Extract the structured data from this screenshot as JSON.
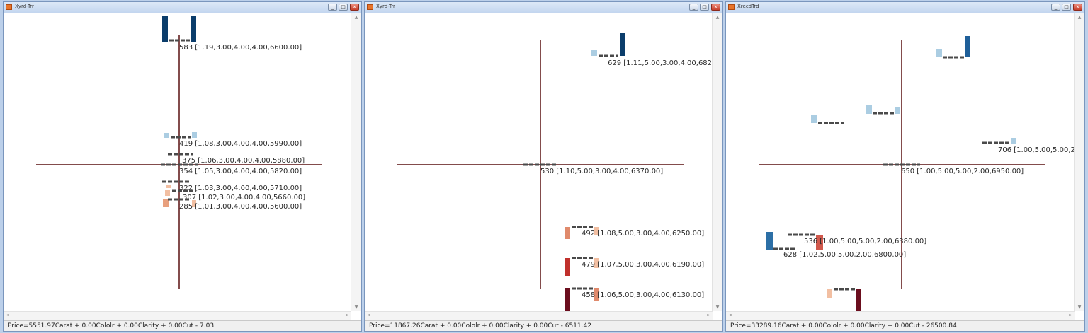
{
  "windows": [
    {
      "title": "Xyrd-Trr",
      "status": "Price=5551.97Carat + 0.00Cololr + 0.00Clarity + 0.00Cut - 7.03",
      "labels": [
        {
          "id": "583",
          "text": "583 [1.19,3.00,4.00,4.00,6600.00]"
        },
        {
          "id": "419",
          "text": "419 [1.08,3.00,4.00,4.00,5990.00]"
        },
        {
          "id": "375",
          "text": "375 [1.06,3.00,4.00,4.00,5880.00]"
        },
        {
          "id": "354",
          "text": "354 [1.05,3.00,4.00,4.00,5820.00]"
        },
        {
          "id": "322",
          "text": "322 [1.03,3.00,4.00,4.00,5710.00]"
        },
        {
          "id": "307",
          "text": "307 [1.02,3.00,4.00,4.00,5660.00]"
        },
        {
          "id": "285",
          "text": "285 [1.01,3.00,4.00,4.00,5600.00]"
        }
      ]
    },
    {
      "title": "Xyrd-Trr",
      "status": "Price=11867.26Carat + 0.00Cololr + 0.00Clarity + 0.00Cut - 6511.42",
      "labels": [
        {
          "id": "629",
          "text": "629 [1.11,5.00,3.00,4.00,6820"
        },
        {
          "id": "530",
          "text": "530 [1.10,5.00,3.00,4.00,6370.00]"
        },
        {
          "id": "492",
          "text": "492 [1.08,5.00,3.00,4.00,6250.00]"
        },
        {
          "id": "479",
          "text": "479 [1.07,5.00,3.00,4.00,6190.00]"
        },
        {
          "id": "458",
          "text": "458 [1.06,5.00,3.00,4.00,6130.00]"
        }
      ]
    },
    {
      "title": "XrecdTrd",
      "status": "Price=33289.16Carat + 0.00Cololr + 0.00Clarity + 0.00Cut - 26500.84",
      "labels": [
        {
          "id": "706",
          "text": "706 [1.00,5.00,5.00,2"
        },
        {
          "id": "650",
          "text": "650 [1.00,5.00,5.00,2.00,6950.00]"
        },
        {
          "id": "536",
          "text": "536 [1.00,5.00,5.00,2.00,6380.00]"
        },
        {
          "id": "628",
          "text": "628 [1.02,5.00,5.00,2.00,6800.00]"
        }
      ]
    }
  ],
  "window_buttons": {
    "minimize": "_",
    "maximize": "□",
    "close": "×"
  },
  "scroll_arrows": {
    "up": "▲",
    "down": "▼",
    "left": "◄",
    "right": "►"
  },
  "colors": {
    "axis": "#5a1010",
    "dark_blue": "#0b3d6b",
    "mid_blue": "#2c6fa6",
    "light_blue": "#abcde2",
    "dark_red": "#6b0e1e",
    "red": "#c0302c",
    "salmon": "#e08a6c",
    "light_salmon": "#f2bfa2",
    "dash": "#4a4a4a"
  }
}
